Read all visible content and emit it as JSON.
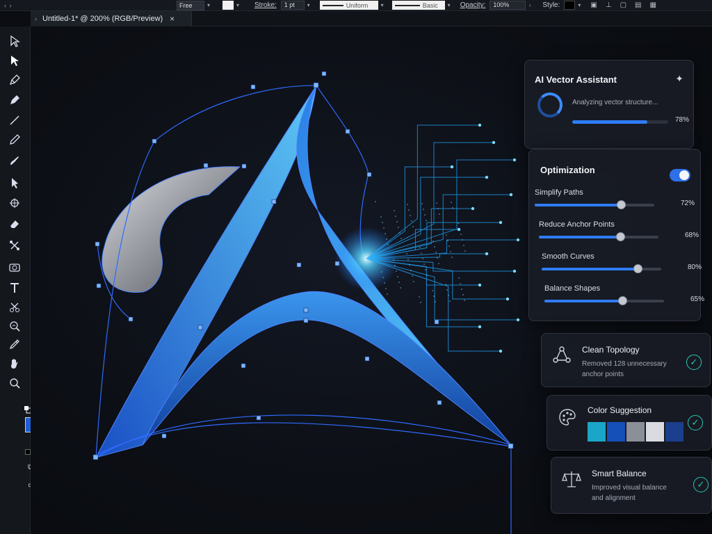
{
  "topbar": {
    "nav": "‹ ›",
    "fill_mode": "Free",
    "stroke_label": "Stroke:",
    "stroke_value": "1 pt",
    "profile": "Uniform",
    "brush": "Basic",
    "opacity_label": "Opacity:",
    "opacity_value": "100%",
    "style_label": "Style:"
  },
  "document": {
    "tab_title": "Untitled-1* @ 200% (RGB/Preview)",
    "close_glyph": "×"
  },
  "tools": [
    {
      "name": "selection-tool-icon",
      "glyph": "select"
    },
    {
      "name": "direct-selection-tool-icon",
      "glyph": "direct"
    },
    {
      "name": "pen-tool-icon",
      "glyph": "pen"
    },
    {
      "name": "curvature-tool-icon",
      "glyph": "pen2"
    },
    {
      "name": "line-tool-icon",
      "glyph": "line"
    },
    {
      "name": "pencil-tool-icon",
      "glyph": "pencil"
    },
    {
      "name": "brush-tool-icon",
      "glyph": "brush"
    },
    {
      "name": "arrow-tool-icon",
      "glyph": "arrow"
    },
    {
      "name": "rotate-tool-icon",
      "glyph": "rotate"
    },
    {
      "name": "eraser-tool-icon",
      "glyph": "eraser"
    },
    {
      "name": "shape-builder-tool-icon",
      "glyph": "builder"
    },
    {
      "name": "camera-tool-icon",
      "glyph": "camera"
    },
    {
      "name": "type-tool-icon",
      "glyph": "type"
    },
    {
      "name": "scissors-tool-icon",
      "glyph": "scissors"
    },
    {
      "name": "zoom-select-tool-icon",
      "glyph": "zoom2"
    },
    {
      "name": "eyedropper-tool-icon",
      "glyph": "eyedropper"
    },
    {
      "name": "hand-tool-icon",
      "glyph": "hand"
    },
    {
      "name": "zoom-tool-icon",
      "glyph": "zoom"
    }
  ],
  "colors": {
    "fill": "#1f5fd6",
    "accent": "#2f7cf6",
    "success": "#2bc6b4"
  },
  "assistant": {
    "title": "AI Vector Assistant",
    "status": "Analyzing vector structure...",
    "progress": 78,
    "progress_label": "78%"
  },
  "optimization": {
    "title": "Optimization",
    "enabled": true,
    "items": [
      {
        "label": "Simplify Paths",
        "value": 72,
        "value_label": "72%"
      },
      {
        "label": "Reduce Anchor Points",
        "value": 68,
        "value_label": "68%"
      },
      {
        "label": "Smooth Curves",
        "value": 80,
        "value_label": "80%"
      },
      {
        "label": "Balance Shapes",
        "value": 65,
        "value_label": "65%"
      }
    ]
  },
  "cards": {
    "topology": {
      "title": "Clean Topology",
      "line1": "Removed 128 unnecessary",
      "line2": "anchor points",
      "icon": "node-graph-icon"
    },
    "color": {
      "title": "Color Suggestion",
      "icon": "palette-icon",
      "swatches": [
        "#1aa6c8",
        "#1550b8",
        "#8a8f98",
        "#d9dbe0",
        "#1b3f8c"
      ]
    },
    "balance": {
      "title": "Smart Balance",
      "line1": "Improved visual balance",
      "line2": "and alignment",
      "icon": "scales-icon"
    }
  }
}
